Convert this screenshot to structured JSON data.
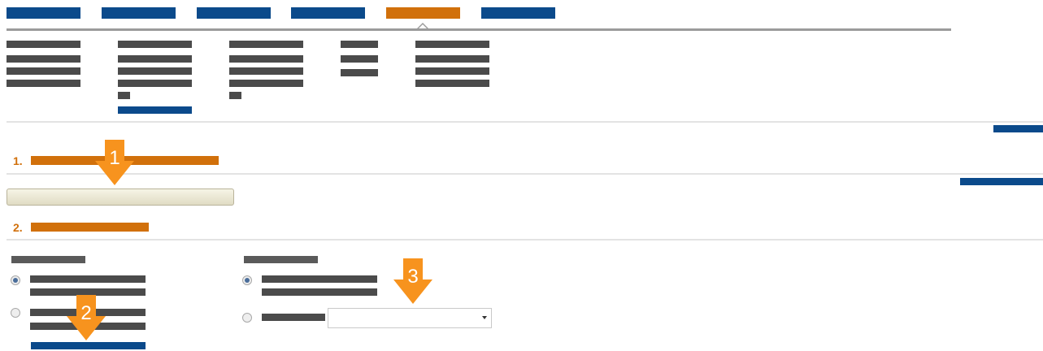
{
  "steps": {
    "step1": {
      "number": "1."
    },
    "step2": {
      "number": "2."
    }
  },
  "callouts": {
    "c1": "1",
    "c2": "2",
    "c3": "3"
  },
  "form": {
    "group1": {
      "radio1_selected": true,
      "radio2_selected": false
    },
    "group2": {
      "radio1_selected": true,
      "radio2_selected": false
    },
    "select_value": ""
  },
  "colors": {
    "link_blue": "#0b4a8b",
    "accent_orange": "#d1700b",
    "callout_orange": "#f7931e"
  }
}
